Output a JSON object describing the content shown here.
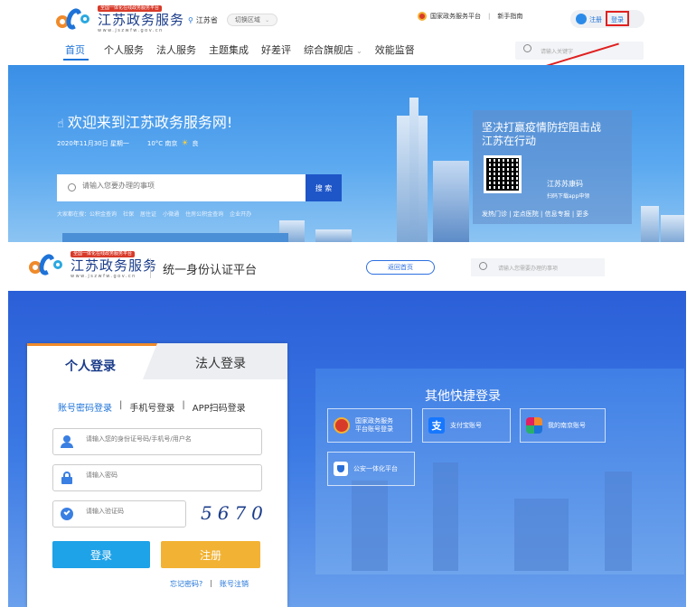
{
  "portal": {
    "logo": {
      "tag": "全国一体化在线政务服务平台",
      "name": "江苏政务服务",
      "url": "www.jszwfw.gov.cn"
    },
    "location": "江苏省",
    "switch_region": "切换区域",
    "top_links": {
      "national": "国家政务服务平台",
      "separator": "|",
      "guide": "新手指南",
      "register": "注册",
      "login": "登录"
    },
    "nav": [
      {
        "label": "首页"
      },
      {
        "label": "个人服务"
      },
      {
        "label": "法人服务"
      },
      {
        "label": "主题集成"
      },
      {
        "label": "好差评"
      },
      {
        "label": "综合旗舰店"
      },
      {
        "label": "效能监督"
      }
    ],
    "search_placeholder": "请输入关键字",
    "banner": {
      "welcome": "欢迎来到江苏政务服务网!",
      "date": "2020年11月30日 星期一",
      "weather": "10°C 南京",
      "air": "良",
      "search_placeholder": "请输入您要办理的事项",
      "search_button": "搜 索",
      "hot_prefix": "大家都在搜：",
      "hot_items": [
        "公积金查询",
        "社保",
        "居住证",
        "小微通",
        "住房公积金查询",
        "企业开办"
      ],
      "promo": {
        "title_line1": "坚决打赢疫情防控阻击战",
        "title_line2": "江苏在行动",
        "code_name": "江苏苏康码",
        "code_tip": "扫码下载app申领",
        "links": "发热门诊 | 定点医院 | 信息专报 | 更多"
      }
    }
  },
  "login_page": {
    "logo": {
      "tag": "全国一体化在线政务服务平台",
      "name": "江苏政务服务",
      "url": "www.jszwfw.gov.cn"
    },
    "platform_title": "统一身份认证平台",
    "back_home": "返回首页",
    "search_placeholder": "请输入您需要办理的事项",
    "tabs": {
      "personal": "个人登录",
      "legal": "法人登录"
    },
    "methods": {
      "password": "账号密码登录",
      "sep1": "|",
      "phone": "手机号登录",
      "sep2": "|",
      "app": "APP扫码登录"
    },
    "fields": {
      "account_placeholder": "请输入您的身份证号码/手机号/用户名",
      "password_placeholder": "请输入密码",
      "captcha_placeholder": "请输入验证码",
      "captcha_value": "5670"
    },
    "login_button": "登录",
    "register_button": "注册",
    "forgot_password": "忘记密码?",
    "footer_sep": "|",
    "cancel_account": "账号注销",
    "quick_login": {
      "title": "其他快捷登录",
      "options": [
        {
          "line1": "国家政务服务",
          "line2": "平台账号登录"
        },
        {
          "line1": "支付宝账号",
          "line2": ""
        },
        {
          "line1": "我的南京账号",
          "line2": ""
        },
        {
          "line1": "公安一体化平台",
          "line2": ""
        }
      ]
    }
  },
  "colors": {
    "brand_blue": "#1e73d8",
    "login_tab_orange": "#f08a2a",
    "login_button": "#1ea2e8",
    "register_button": "#f2b233",
    "highlight_red": "#e02020"
  }
}
